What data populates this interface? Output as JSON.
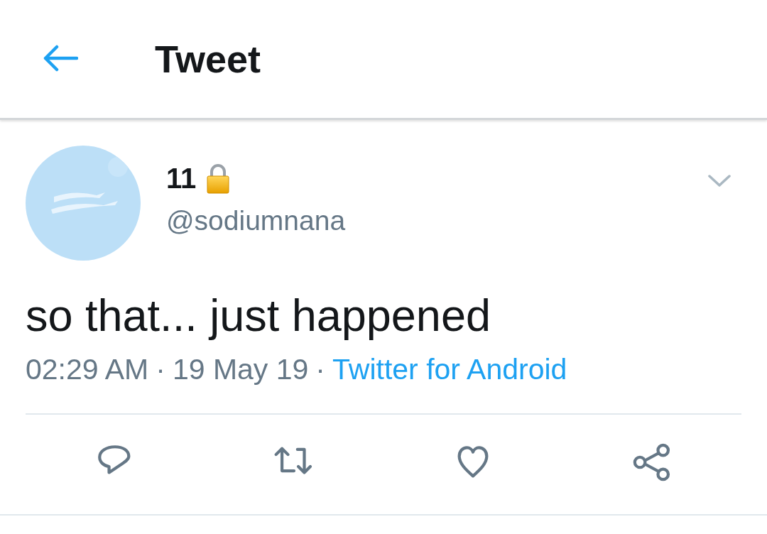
{
  "header": {
    "title": "Tweet"
  },
  "tweet": {
    "author": {
      "name": "11",
      "locked": true,
      "handle": "@sodiumnana"
    },
    "text": "so that... just happened",
    "meta": [
      {
        "kind": "plain",
        "text": "02:29 AM"
      },
      {
        "kind": "separator",
        "text": "·"
      },
      {
        "kind": "plain",
        "text": "19 May 19"
      },
      {
        "kind": "separator",
        "text": "·"
      },
      {
        "kind": "link",
        "text": "Twitter for Android"
      }
    ],
    "actions": [
      {
        "kind": "reply"
      },
      {
        "kind": "retweet"
      },
      {
        "kind": "like"
      },
      {
        "kind": "share"
      }
    ]
  }
}
